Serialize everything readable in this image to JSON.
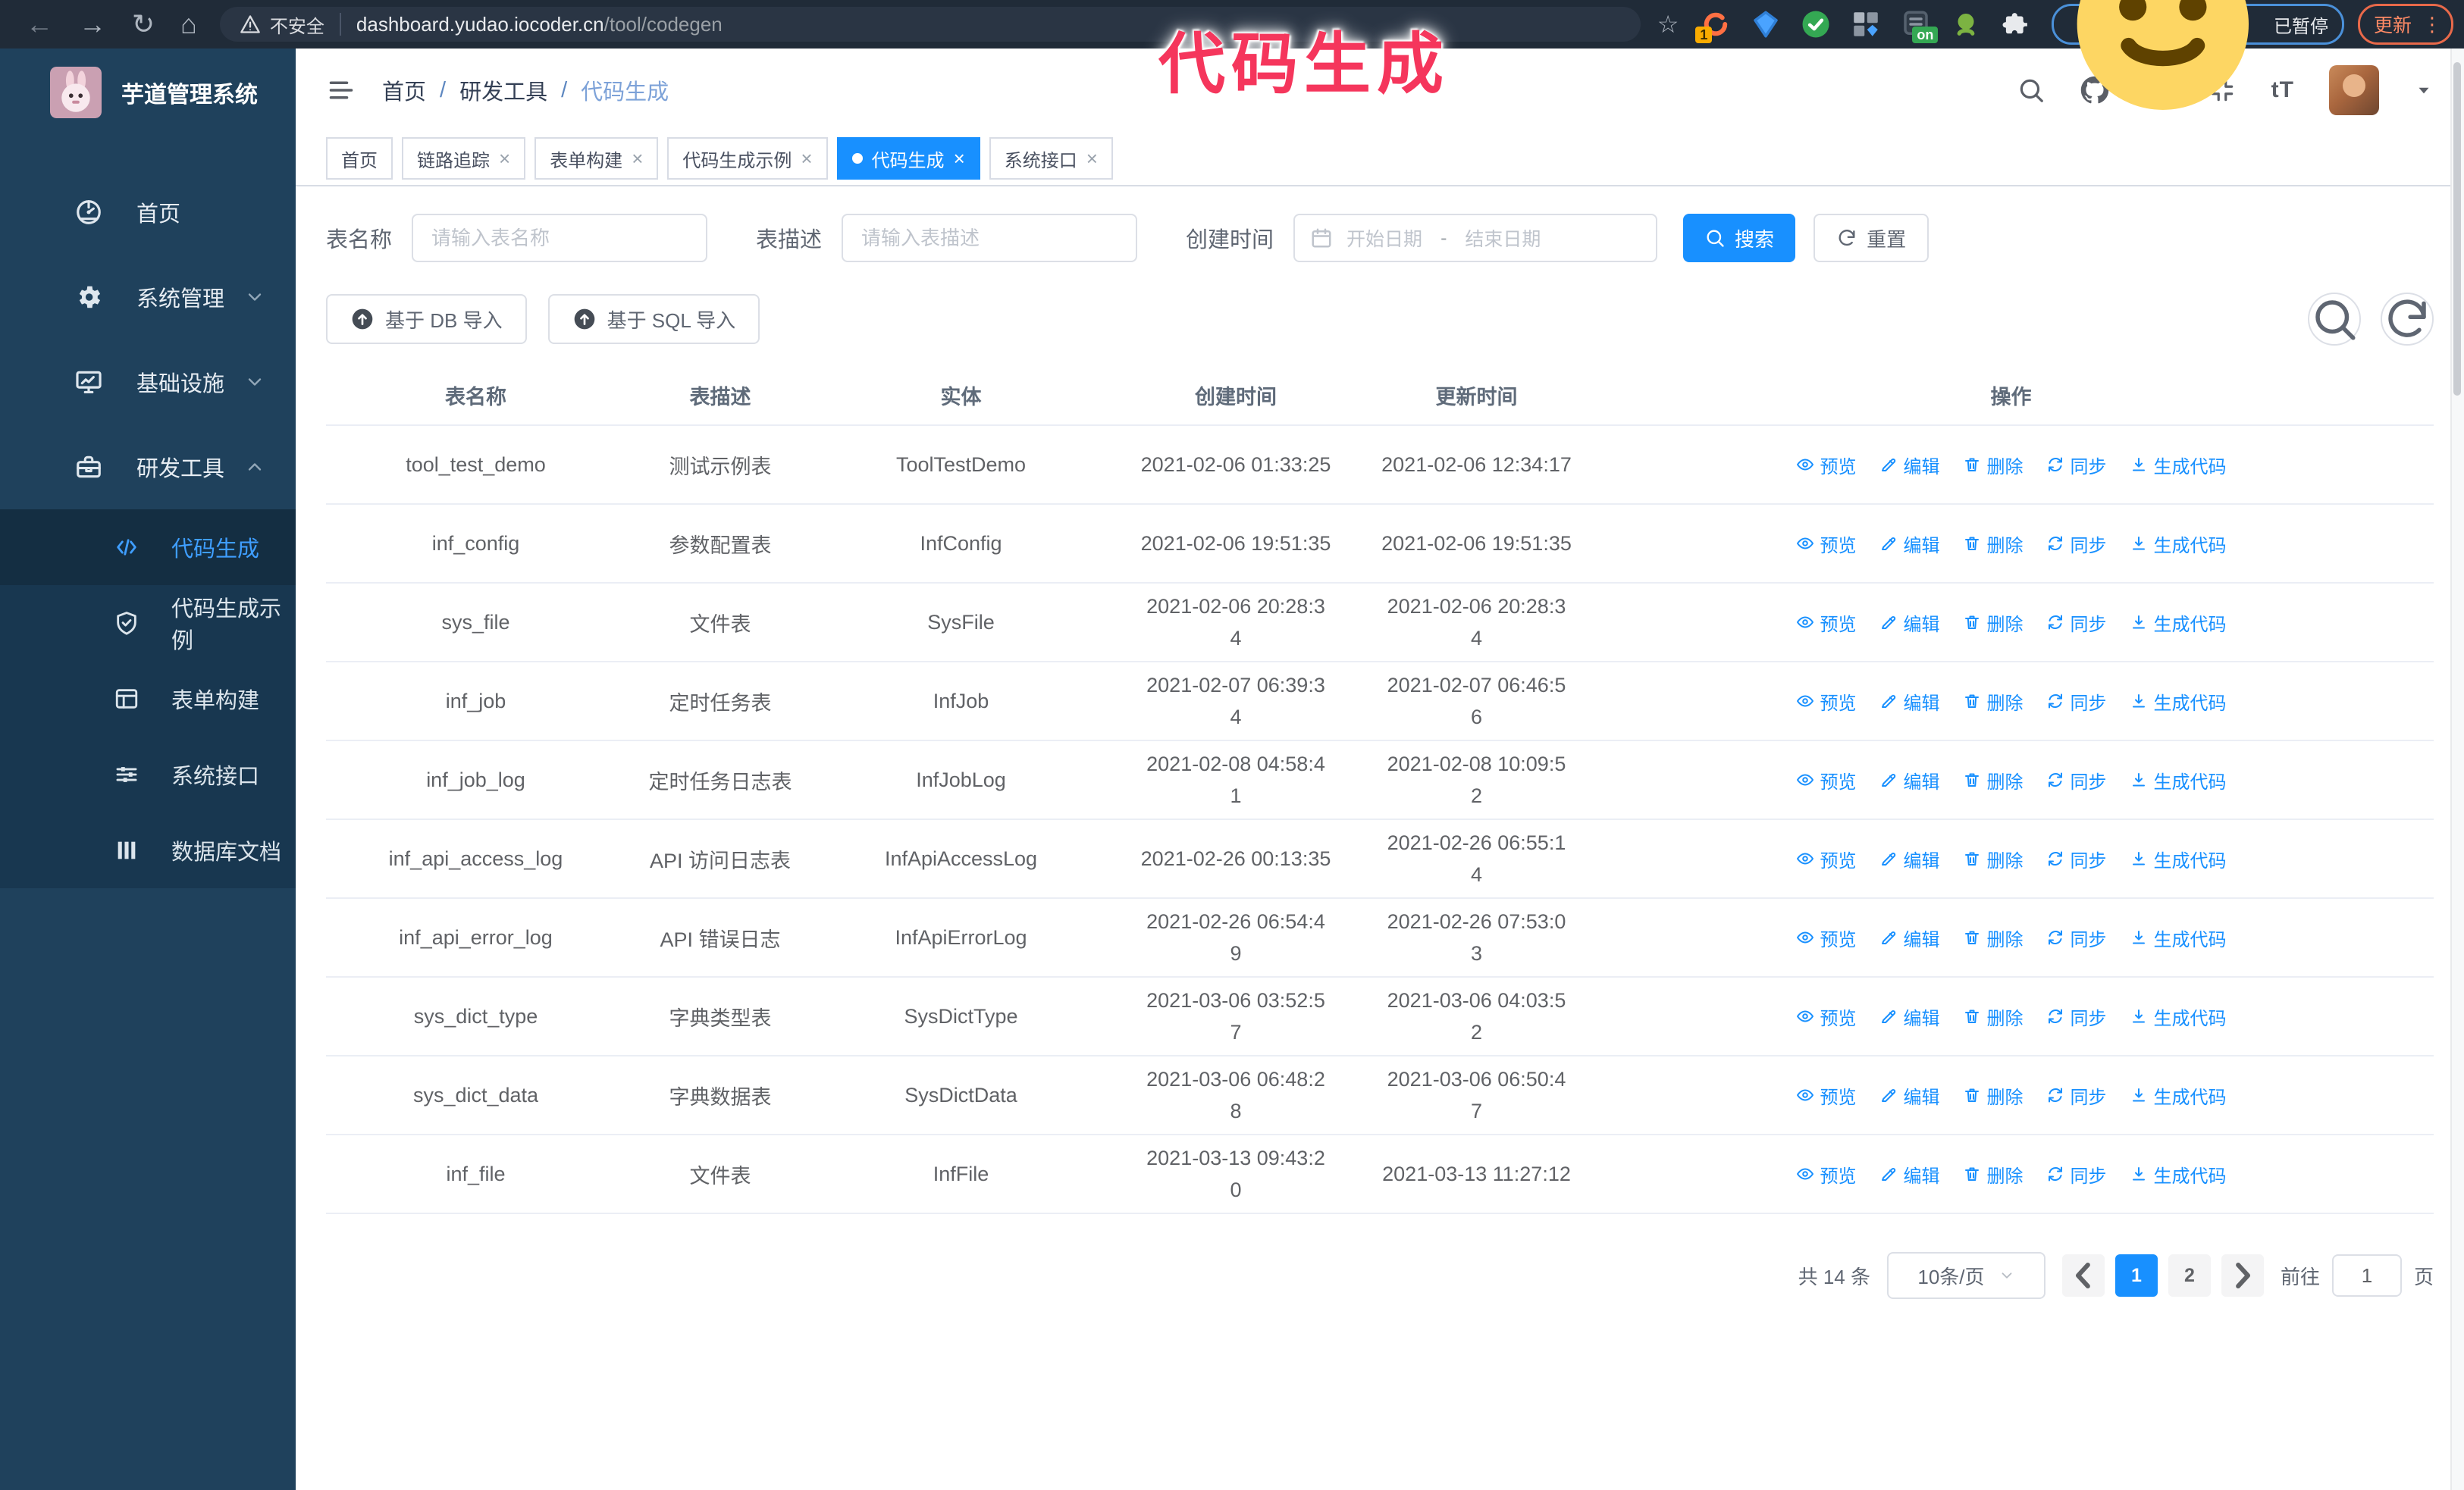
{
  "browser": {
    "url_secure_label": "不安全",
    "url_host": "dashboard.yudao.iocoder.cn",
    "url_path": "/tool/codegen",
    "ext_badge_1": "1",
    "ext_badge_on": "on",
    "paused_badge": "已暂停",
    "update_button": "更新"
  },
  "annotation": {
    "text": "代码生成",
    "color": "#f5365c"
  },
  "sidebar": {
    "title": "芋道管理系统",
    "menu": [
      {
        "key": "home",
        "label": "首页",
        "icon": "dashboard-icon"
      },
      {
        "key": "system",
        "label": "系统管理",
        "icon": "gear-icon",
        "chevron": "down"
      },
      {
        "key": "infra",
        "label": "基础设施",
        "icon": "monitor-icon",
        "chevron": "down"
      },
      {
        "key": "devtools",
        "label": "研发工具",
        "icon": "toolbox-icon",
        "chevron": "up",
        "open": true
      }
    ],
    "submenu": [
      {
        "key": "codegen",
        "label": "代码生成",
        "icon": "code-icon",
        "active": true
      },
      {
        "key": "codegen-example",
        "label": "代码生成示例",
        "icon": "shield-check-icon"
      },
      {
        "key": "form-builder",
        "label": "表单构建",
        "icon": "form-icon"
      },
      {
        "key": "system-api",
        "label": "系统接口",
        "icon": "sliders-icon"
      },
      {
        "key": "db-doc",
        "label": "数据库文档",
        "icon": "database-icon"
      }
    ]
  },
  "navbar": {
    "breadcrumb": [
      {
        "key": "home",
        "label": "首页"
      },
      {
        "key": "devtools",
        "label": "研发工具"
      },
      {
        "key": "codegen",
        "label": "代码生成",
        "current": true
      }
    ]
  },
  "tabs": [
    {
      "key": "home",
      "label": "首页"
    },
    {
      "key": "tracing",
      "label": "链路追踪",
      "closable": true
    },
    {
      "key": "form-builder",
      "label": "表单构建",
      "closable": true
    },
    {
      "key": "codegen-example",
      "label": "代码生成示例",
      "closable": true
    },
    {
      "key": "codegen",
      "label": "代码生成",
      "closable": true,
      "active": true
    },
    {
      "key": "system-api",
      "label": "系统接口",
      "closable": true
    }
  ],
  "filters": {
    "name_label": "表名称",
    "name_placeholder": "请输入表名称",
    "desc_label": "表描述",
    "desc_placeholder": "请输入表描述",
    "time_label": "创建时间",
    "start_placeholder": "开始日期",
    "range_separator": "-",
    "end_placeholder": "结束日期",
    "search_label": "搜索",
    "reset_label": "重置"
  },
  "toolbar": {
    "db_import": "基于 DB 导入",
    "sql_import": "基于 SQL 导入"
  },
  "table": {
    "headers": [
      "表名称",
      "表描述",
      "实体",
      "创建时间",
      "更新时间",
      "操作"
    ],
    "action_labels": [
      {
        "key": "preview",
        "label": "预览",
        "icon": "eye-icon"
      },
      {
        "key": "edit",
        "label": "编辑",
        "icon": "edit-icon"
      },
      {
        "key": "delete",
        "label": "删除",
        "icon": "delete-icon"
      },
      {
        "key": "sync",
        "label": "同步",
        "icon": "sync-icon"
      },
      {
        "key": "generate",
        "label": "生成代码",
        "icon": "download-icon"
      }
    ],
    "rows": [
      {
        "name": "tool_test_demo",
        "desc": "测试示例表",
        "entity": "ToolTestDemo",
        "created": "2021-02-06 01:33:25",
        "updated": "2021-02-06 12:34:17",
        "created_wrap": false,
        "updated_wrap": false
      },
      {
        "name": "inf_config",
        "desc": "参数配置表",
        "entity": "InfConfig",
        "created": "2021-02-06 19:51:35",
        "updated": "2021-02-06 19:51:35",
        "created_wrap": false,
        "updated_wrap": false
      },
      {
        "name": "sys_file",
        "desc": "文件表",
        "entity": "SysFile",
        "created": "2021-02-06 20:28:34",
        "updated": "2021-02-06 20:28:34",
        "created_wrap": true,
        "updated_wrap": true
      },
      {
        "name": "inf_job",
        "desc": "定时任务表",
        "entity": "InfJob",
        "created": "2021-02-07 06:39:34",
        "updated": "2021-02-07 06:46:56",
        "created_wrap": true,
        "updated_wrap": true
      },
      {
        "name": "inf_job_log",
        "desc": "定时任务日志表",
        "entity": "InfJobLog",
        "created": "2021-02-08 04:58:41",
        "updated": "2021-02-08 10:09:52",
        "created_wrap": true,
        "updated_wrap": true
      },
      {
        "name": "inf_api_access_log",
        "desc": "API 访问日志表",
        "entity": "InfApiAccessLog",
        "created": "2021-02-26 00:13:35",
        "updated": "2021-02-26 06:55:14",
        "created_wrap": false,
        "updated_wrap": true
      },
      {
        "name": "inf_api_error_log",
        "desc": "API 错误日志",
        "entity": "InfApiErrorLog",
        "created": "2021-02-26 06:54:49",
        "updated": "2021-02-26 07:53:03",
        "created_wrap": true,
        "updated_wrap": true
      },
      {
        "name": "sys_dict_type",
        "desc": "字典类型表",
        "entity": "SysDictType",
        "created": "2021-03-06 03:52:57",
        "updated": "2021-03-06 04:03:52",
        "created_wrap": true,
        "updated_wrap": true
      },
      {
        "name": "sys_dict_data",
        "desc": "字典数据表",
        "entity": "SysDictData",
        "created": "2021-03-06 06:48:28",
        "updated": "2021-03-06 06:50:47",
        "created_wrap": true,
        "updated_wrap": true
      },
      {
        "name": "inf_file",
        "desc": "文件表",
        "entity": "InfFile",
        "created": "2021-03-13 09:43:20",
        "updated": "2021-03-13 11:27:12",
        "created_wrap": true,
        "updated_wrap": false
      }
    ]
  },
  "pagination": {
    "total_text": "共 14 条",
    "page_size": "10条/页",
    "pages": [
      "1",
      "2"
    ],
    "active_page": "1",
    "goto_label": "前往",
    "goto_value": "1",
    "page_suffix": "页"
  },
  "colors": {
    "primary": "#1890ff",
    "sidebar_bg": "#1f415c",
    "submenu_bg": "#183750",
    "annotation": "#f5365c"
  }
}
